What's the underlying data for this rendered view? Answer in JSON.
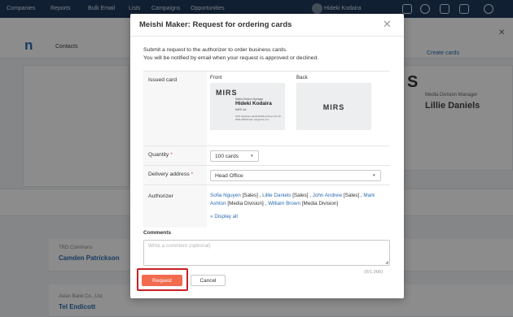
{
  "background": {
    "nav_items": [
      "Companies",
      "Reports",
      "Bulk Email",
      "Lists",
      "Campaigns",
      "Opportunities"
    ],
    "user_name": "Hideki Kodaira",
    "brand": "n",
    "contacts_tab": "Contacts",
    "create_cards": "Create cards",
    "right_title": "Media Division Manager",
    "right_name": "Lillie Daniels",
    "rows": [
      {
        "company": "TRD Commons",
        "person": "Camden Patrickson"
      },
      {
        "company": "Asian Bank Co., Ltd.",
        "person": "Tel Endicott"
      }
    ]
  },
  "modal": {
    "title": "Meishi Maker: Request for ordering cards",
    "intro_line1": "Submit a request to the authorizer to order business cards.",
    "intro_line2": "You will be notified by email when your request is approved or declined.",
    "issued_card": {
      "label": "Issued card",
      "front_label": "Front",
      "back_label": "Back",
      "front": {
        "logo": "MIRS",
        "title": "Media Division Manager",
        "name": "Hideki Kodaira",
        "company": "MIRS Ltd.",
        "address": "1001 Appletree Hanka Building Tokyo Tel: 03-0000-0000 Email: info@mirs.com"
      },
      "back": {
        "logo": "MIRS"
      }
    },
    "quantity": {
      "label": "Quantity",
      "required_mark": "*",
      "value": "100 cards"
    },
    "delivery": {
      "label": "Delivery address",
      "required_mark": "*",
      "value": "Head Office"
    },
    "authorizer": {
      "label": "Authorizer",
      "people": [
        {
          "name": "Sofia Nguyen",
          "dept": "[Sales]"
        },
        {
          "name": "Lillie Daniels",
          "dept": "[Sales]"
        },
        {
          "name": "John Andrew",
          "dept": "[Sales]"
        },
        {
          "name": "Mark Ashton",
          "dept": "[Media Division]"
        },
        {
          "name": "William Brown",
          "dept": "[Media Division]"
        }
      ],
      "display_all": "» Display all"
    },
    "comments": {
      "label": "Comments",
      "placeholder": "Write a comment (optional)",
      "counter": "(0/1,000)"
    },
    "request_button": "Request",
    "cancel_button": "Cancel",
    "highlight_color": "#c81f26",
    "accent_color": "#f26b4f",
    "link_color": "#2b6cb0"
  }
}
